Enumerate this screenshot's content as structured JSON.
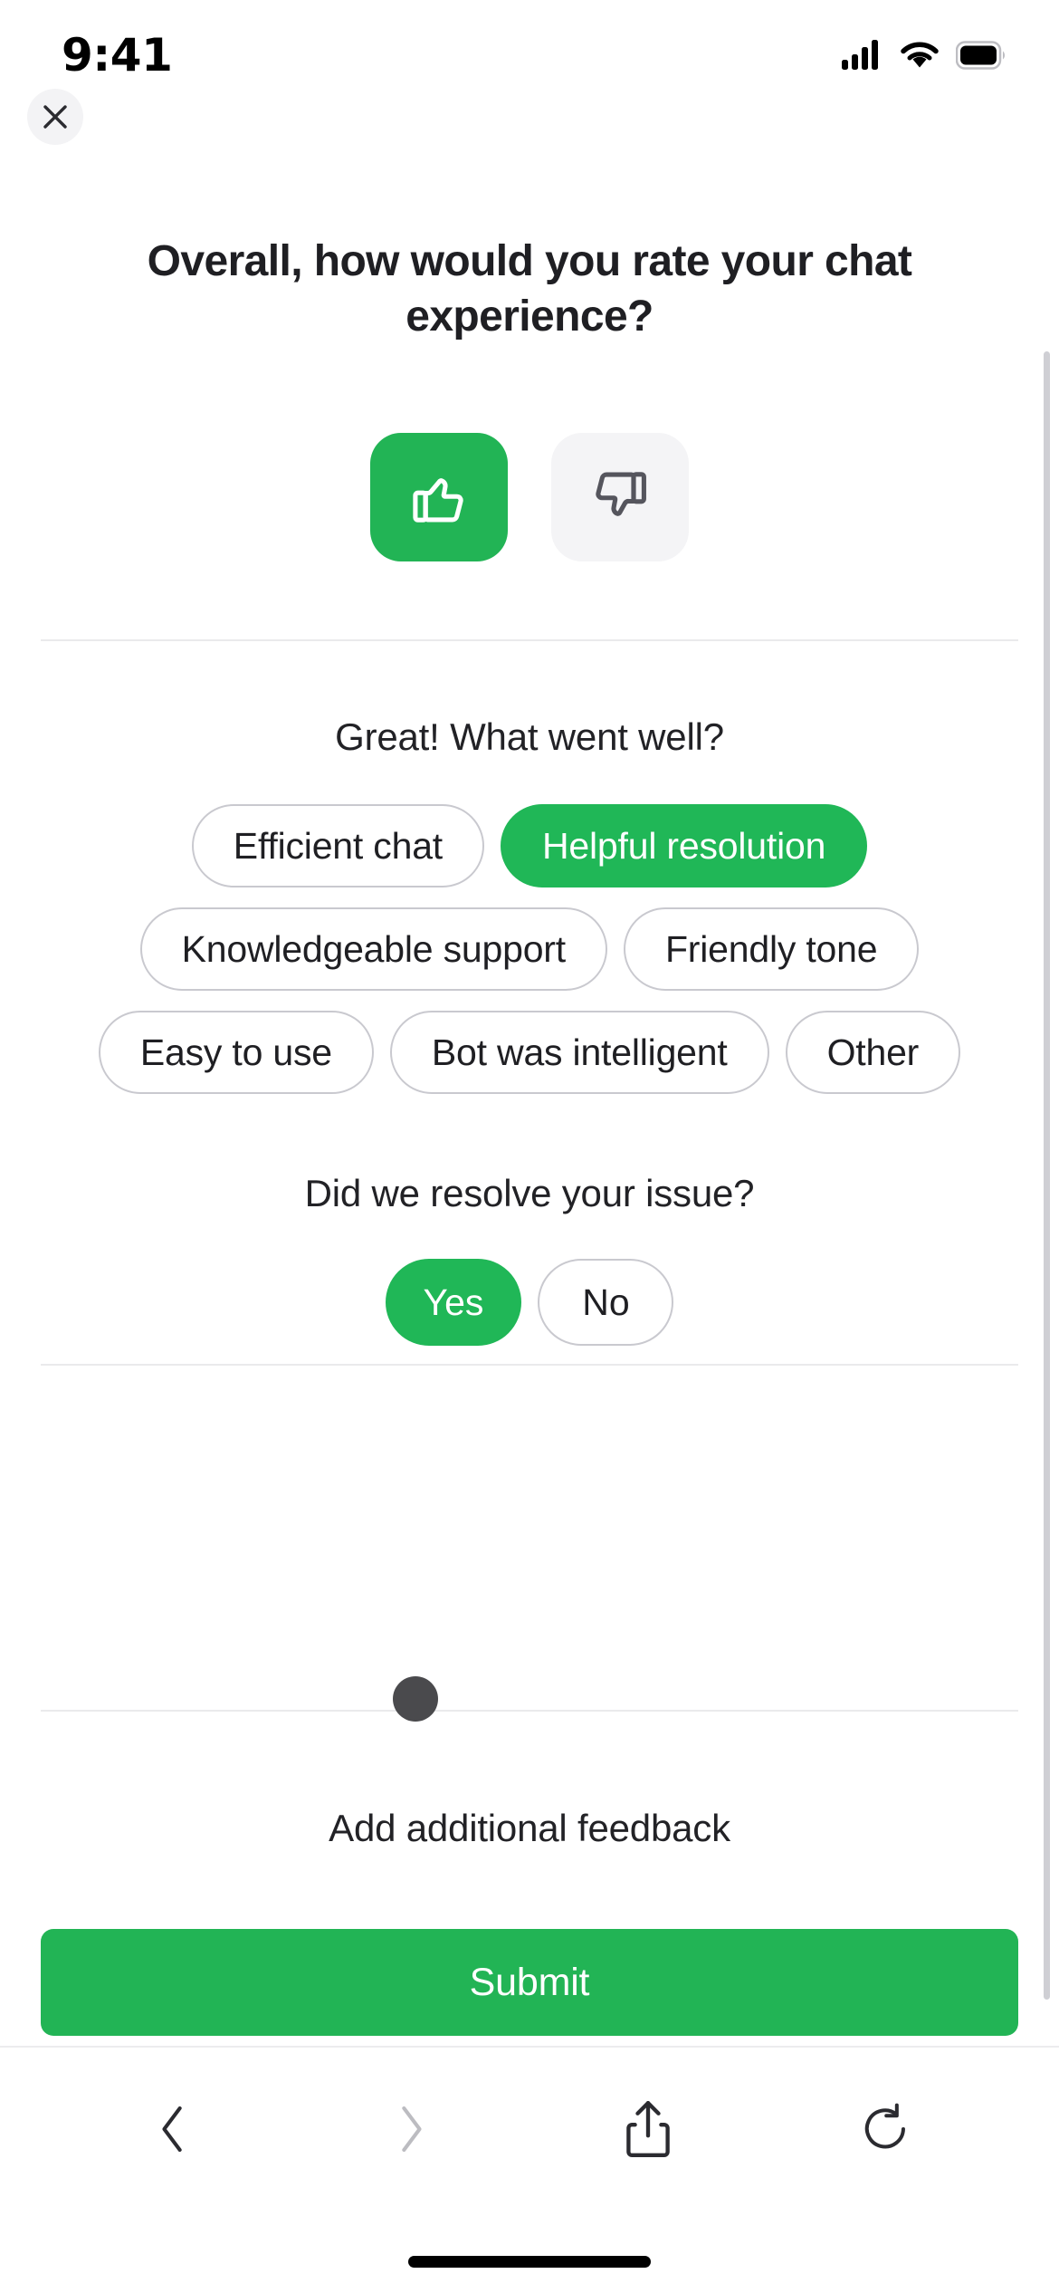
{
  "status_bar": {
    "time": "9:41",
    "icons": [
      "cellular-signal-icon",
      "wifi-icon",
      "battery-icon"
    ]
  },
  "header": {
    "close_icon": "close-icon",
    "title": "Overall, how would you rate your chat experience?"
  },
  "rating": {
    "thumbs_up": {
      "icon": "thumbs-up-icon",
      "selected": true
    },
    "thumbs_down": {
      "icon": "thumbs-down-icon",
      "selected": false
    }
  },
  "positive_section": {
    "prompt": "Great! What went well?",
    "chips": [
      {
        "label": "Efficient chat",
        "selected": false
      },
      {
        "label": "Helpful resolution",
        "selected": true
      },
      {
        "label": "Knowledgeable support",
        "selected": false
      },
      {
        "label": "Friendly tone",
        "selected": false
      },
      {
        "label": "Easy to use",
        "selected": false
      },
      {
        "label": "Bot was intelligent",
        "selected": false
      },
      {
        "label": "Other",
        "selected": false
      }
    ]
  },
  "resolution_section": {
    "prompt": "Did we resolve your issue?",
    "options": [
      {
        "label": "Yes",
        "selected": true
      },
      {
        "label": "No",
        "selected": false
      }
    ]
  },
  "feedback_section": {
    "prompt": "Add additional feedback"
  },
  "submit": {
    "label": "Submit"
  },
  "browser_toolbar": {
    "back_icon": "chevron-left-icon",
    "forward_icon": "chevron-right-icon",
    "share_icon": "share-icon",
    "reload_icon": "reload-icon"
  },
  "colors": {
    "accent_green": "#22b455",
    "chip_selected_green": "#20b757",
    "chip_border": "#c9c9cf",
    "divider": "#eaeaec",
    "text_primary": "#1f1f23",
    "thumbs_down_bg": "#f4f4f6",
    "cursor_dot": "#4a4a4d"
  }
}
